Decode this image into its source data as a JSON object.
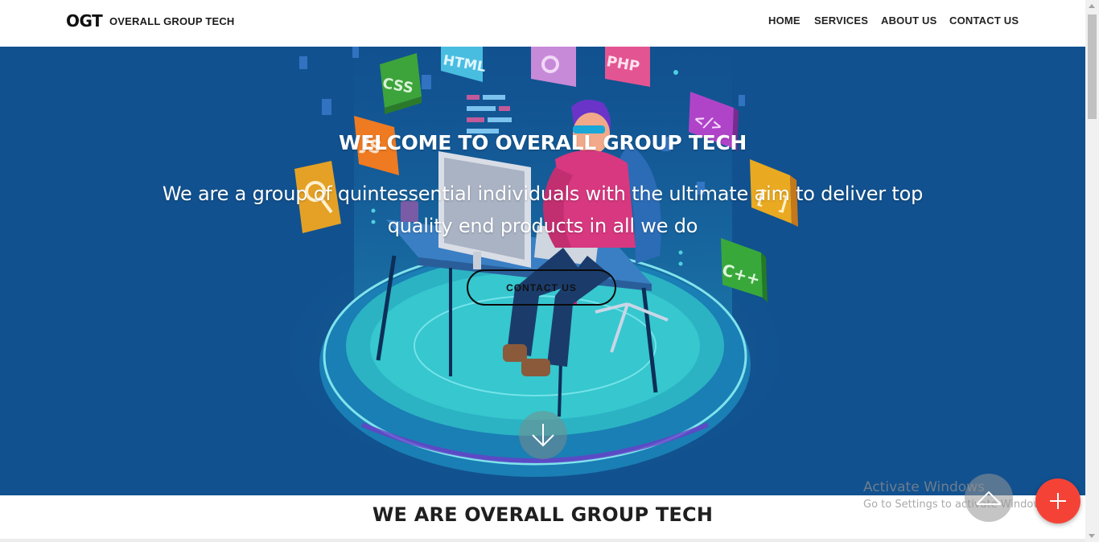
{
  "header": {
    "logo": "OGT",
    "brand_name": "OVERALL GROUP TECH",
    "nav": [
      {
        "label": "HOME"
      },
      {
        "label": "SERVICES"
      },
      {
        "label": "ABOUT US"
      },
      {
        "label": "CONTACT US"
      }
    ]
  },
  "hero": {
    "title": "WELCOME TO OVERALL GROUP TECH",
    "subtitle": "We are a group of quintessential individuals with the ultimate aim to deliver top quality end products in all we do",
    "cta_label": "CONTACT US",
    "tiles": [
      "CSS",
      "HTML",
      "PHP",
      "</>",
      "C++",
      "JS"
    ],
    "background_color": "#11518f"
  },
  "section": {
    "title": "WE ARE OVERALL GROUP TECH"
  },
  "watermark": {
    "title": "Activate Windows",
    "subtitle": "Go to Settings to activate Windows."
  },
  "icons": {
    "scroll_down": "arrow-down-icon",
    "back_to_top": "chevron-up-icon",
    "fab": "plus-icon"
  },
  "colors": {
    "fab": "#f44336",
    "nav_text": "#222222"
  }
}
